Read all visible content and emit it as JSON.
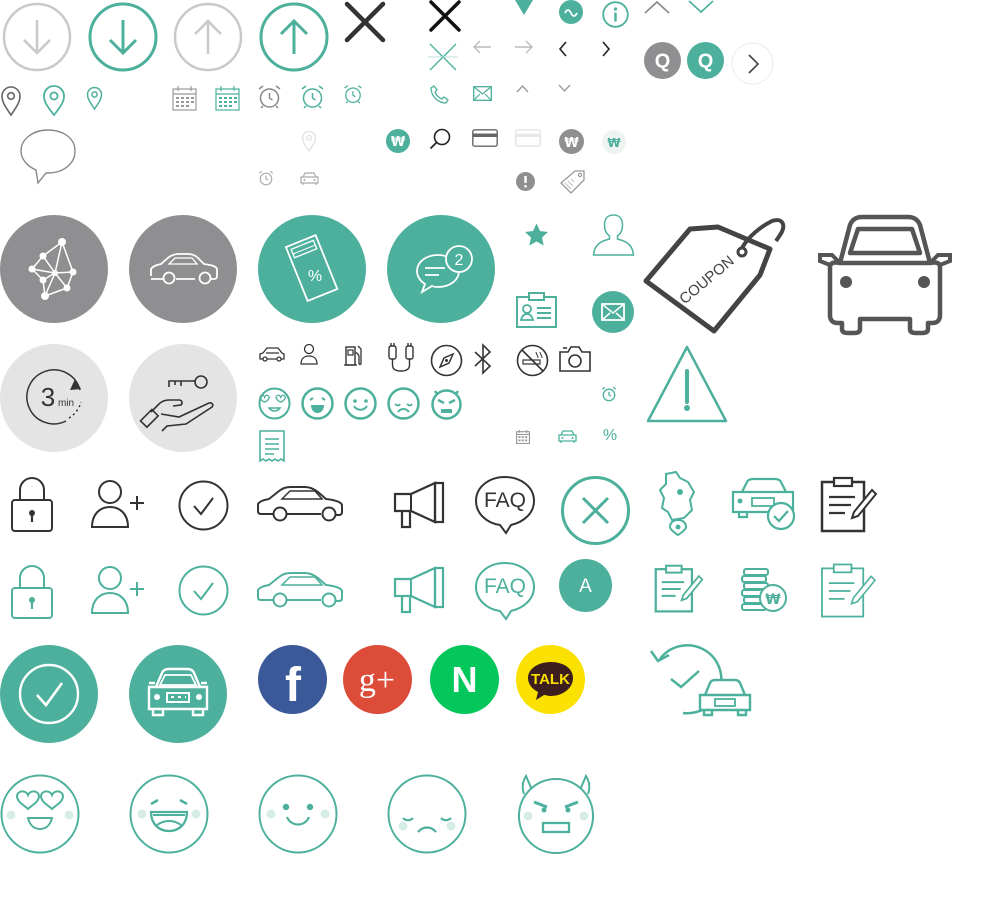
{
  "colors": {
    "teal": "#4cb09c",
    "gray": "#8f8f92",
    "light_gray": "#c9c9c9",
    "pale_gray": "#e4e4e4",
    "dark": "#333333",
    "facebook": "#3b5998",
    "google_plus": "#dd4b39",
    "naver": "#03c75a",
    "kakao": "#fae100"
  },
  "icons": {
    "coupon_tag": {
      "text": "COUPON"
    },
    "chat_badge": {
      "count": "2"
    },
    "three_min": {
      "number": "3",
      "unit": "min"
    },
    "faq_dark": {
      "text": "FAQ"
    },
    "faq_teal": {
      "text": "FAQ"
    },
    "letter_badge": {
      "text": "A"
    },
    "won_sign": {
      "text": "₩"
    },
    "percent_sign": {
      "text": "%"
    },
    "search_badge": {
      "text": "Q"
    },
    "kakao_talk": {
      "text": "TALK"
    },
    "google_plus": {
      "text": "g+"
    },
    "facebook": {
      "text": "f"
    },
    "naver": {
      "text": "N"
    }
  }
}
